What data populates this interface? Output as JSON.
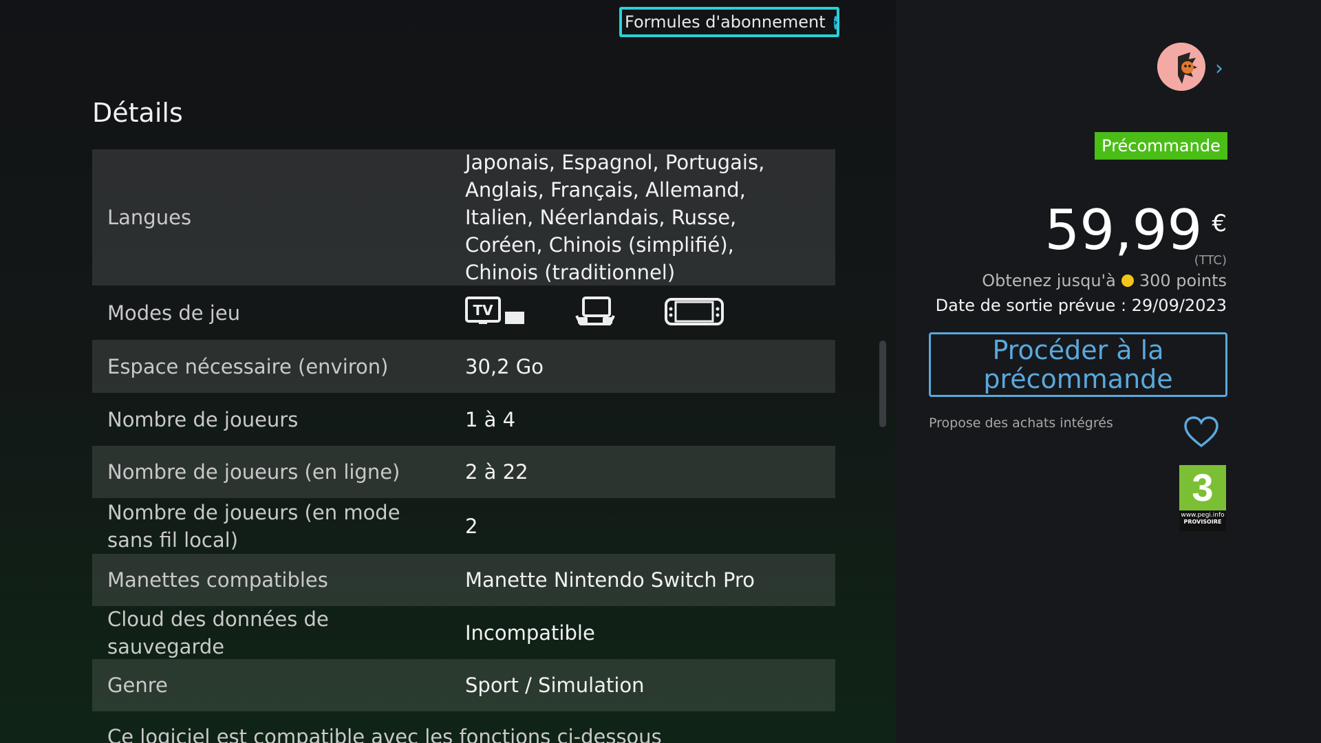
{
  "header": {
    "subscription_label": "Formules d'abonnement"
  },
  "details": {
    "title": "Détails",
    "rows": [
      {
        "label": "Langues",
        "value": "Japonais, Espagnol, Portugais, Anglais, Français, Allemand, Italien, Néerlandais, Russe, Coréen, Chinois (simplifié), Chinois (traditionnel)"
      },
      {
        "label": "Modes de jeu",
        "modes": [
          "tv-mode-icon",
          "tabletop-mode-icon",
          "handheld-mode-icon"
        ]
      },
      {
        "label": "Espace nécessaire (environ)",
        "value": "30,2 Go"
      },
      {
        "label": "Nombre de joueurs",
        "value": "1 à 4"
      },
      {
        "label": "Nombre de joueurs (en ligne)",
        "value": "2 à 22"
      },
      {
        "label": "Nombre de joueurs (en mode sans fil local)",
        "value": "2"
      },
      {
        "label": "Manettes compatibles",
        "value": "Manette Nintendo Switch Pro"
      },
      {
        "label": "Cloud des données de sauvegarde",
        "value": "Incompatible"
      },
      {
        "label": "Genre",
        "value": "Sport / Simulation"
      }
    ],
    "footer_note": "Ce logiciel est compatible avec les fonctions ci-dessous"
  },
  "purchase": {
    "badge": "Précommande",
    "price": "59,99",
    "currency": "€",
    "tax_note": "(TTC)",
    "points_prefix": "Obtenez jusqu'à",
    "points_value": "300 points",
    "release_date": "Date de sortie prévue : 29/09/2023",
    "preorder_button": "Procéder à la précommande",
    "in_app_purchases": "Propose des achats intégrés",
    "rating": {
      "value": "3",
      "url": "www.pegi.info",
      "provisional": "PROVISOIRE"
    }
  },
  "colors": {
    "accent_cyan": "#28d2d8",
    "accent_blue": "#5aa9dd",
    "badge_green": "#4bbd17",
    "pegi_green": "#7bc034"
  }
}
